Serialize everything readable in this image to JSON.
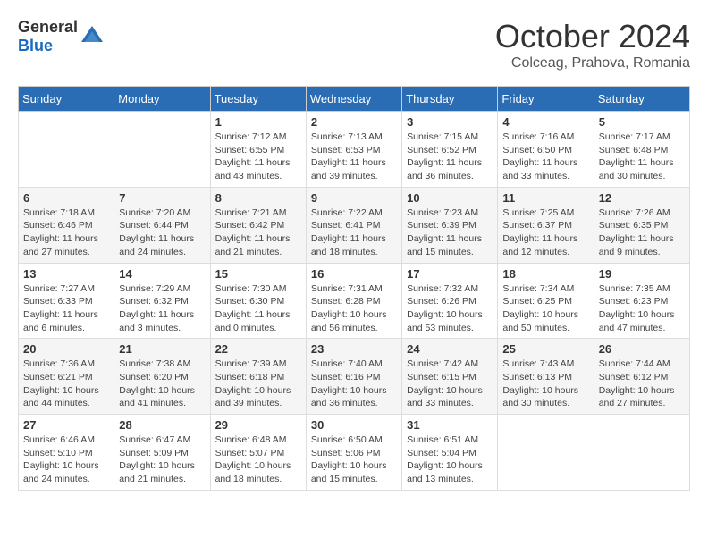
{
  "header": {
    "logo_general": "General",
    "logo_blue": "Blue",
    "month": "October 2024",
    "location": "Colceag, Prahova, Romania"
  },
  "days_of_week": [
    "Sunday",
    "Monday",
    "Tuesday",
    "Wednesday",
    "Thursday",
    "Friday",
    "Saturday"
  ],
  "weeks": [
    [
      {
        "day": "",
        "info": ""
      },
      {
        "day": "",
        "info": ""
      },
      {
        "day": "1",
        "info": "Sunrise: 7:12 AM\nSunset: 6:55 PM\nDaylight: 11 hours and 43 minutes."
      },
      {
        "day": "2",
        "info": "Sunrise: 7:13 AM\nSunset: 6:53 PM\nDaylight: 11 hours and 39 minutes."
      },
      {
        "day": "3",
        "info": "Sunrise: 7:15 AM\nSunset: 6:52 PM\nDaylight: 11 hours and 36 minutes."
      },
      {
        "day": "4",
        "info": "Sunrise: 7:16 AM\nSunset: 6:50 PM\nDaylight: 11 hours and 33 minutes."
      },
      {
        "day": "5",
        "info": "Sunrise: 7:17 AM\nSunset: 6:48 PM\nDaylight: 11 hours and 30 minutes."
      }
    ],
    [
      {
        "day": "6",
        "info": "Sunrise: 7:18 AM\nSunset: 6:46 PM\nDaylight: 11 hours and 27 minutes."
      },
      {
        "day": "7",
        "info": "Sunrise: 7:20 AM\nSunset: 6:44 PM\nDaylight: 11 hours and 24 minutes."
      },
      {
        "day": "8",
        "info": "Sunrise: 7:21 AM\nSunset: 6:42 PM\nDaylight: 11 hours and 21 minutes."
      },
      {
        "day": "9",
        "info": "Sunrise: 7:22 AM\nSunset: 6:41 PM\nDaylight: 11 hours and 18 minutes."
      },
      {
        "day": "10",
        "info": "Sunrise: 7:23 AM\nSunset: 6:39 PM\nDaylight: 11 hours and 15 minutes."
      },
      {
        "day": "11",
        "info": "Sunrise: 7:25 AM\nSunset: 6:37 PM\nDaylight: 11 hours and 12 minutes."
      },
      {
        "day": "12",
        "info": "Sunrise: 7:26 AM\nSunset: 6:35 PM\nDaylight: 11 hours and 9 minutes."
      }
    ],
    [
      {
        "day": "13",
        "info": "Sunrise: 7:27 AM\nSunset: 6:33 PM\nDaylight: 11 hours and 6 minutes."
      },
      {
        "day": "14",
        "info": "Sunrise: 7:29 AM\nSunset: 6:32 PM\nDaylight: 11 hours and 3 minutes."
      },
      {
        "day": "15",
        "info": "Sunrise: 7:30 AM\nSunset: 6:30 PM\nDaylight: 11 hours and 0 minutes."
      },
      {
        "day": "16",
        "info": "Sunrise: 7:31 AM\nSunset: 6:28 PM\nDaylight: 10 hours and 56 minutes."
      },
      {
        "day": "17",
        "info": "Sunrise: 7:32 AM\nSunset: 6:26 PM\nDaylight: 10 hours and 53 minutes."
      },
      {
        "day": "18",
        "info": "Sunrise: 7:34 AM\nSunset: 6:25 PM\nDaylight: 10 hours and 50 minutes."
      },
      {
        "day": "19",
        "info": "Sunrise: 7:35 AM\nSunset: 6:23 PM\nDaylight: 10 hours and 47 minutes."
      }
    ],
    [
      {
        "day": "20",
        "info": "Sunrise: 7:36 AM\nSunset: 6:21 PM\nDaylight: 10 hours and 44 minutes."
      },
      {
        "day": "21",
        "info": "Sunrise: 7:38 AM\nSunset: 6:20 PM\nDaylight: 10 hours and 41 minutes."
      },
      {
        "day": "22",
        "info": "Sunrise: 7:39 AM\nSunset: 6:18 PM\nDaylight: 10 hours and 39 minutes."
      },
      {
        "day": "23",
        "info": "Sunrise: 7:40 AM\nSunset: 6:16 PM\nDaylight: 10 hours and 36 minutes."
      },
      {
        "day": "24",
        "info": "Sunrise: 7:42 AM\nSunset: 6:15 PM\nDaylight: 10 hours and 33 minutes."
      },
      {
        "day": "25",
        "info": "Sunrise: 7:43 AM\nSunset: 6:13 PM\nDaylight: 10 hours and 30 minutes."
      },
      {
        "day": "26",
        "info": "Sunrise: 7:44 AM\nSunset: 6:12 PM\nDaylight: 10 hours and 27 minutes."
      }
    ],
    [
      {
        "day": "27",
        "info": "Sunrise: 6:46 AM\nSunset: 5:10 PM\nDaylight: 10 hours and 24 minutes."
      },
      {
        "day": "28",
        "info": "Sunrise: 6:47 AM\nSunset: 5:09 PM\nDaylight: 10 hours and 21 minutes."
      },
      {
        "day": "29",
        "info": "Sunrise: 6:48 AM\nSunset: 5:07 PM\nDaylight: 10 hours and 18 minutes."
      },
      {
        "day": "30",
        "info": "Sunrise: 6:50 AM\nSunset: 5:06 PM\nDaylight: 10 hours and 15 minutes."
      },
      {
        "day": "31",
        "info": "Sunrise: 6:51 AM\nSunset: 5:04 PM\nDaylight: 10 hours and 13 minutes."
      },
      {
        "day": "",
        "info": ""
      },
      {
        "day": "",
        "info": ""
      }
    ]
  ]
}
